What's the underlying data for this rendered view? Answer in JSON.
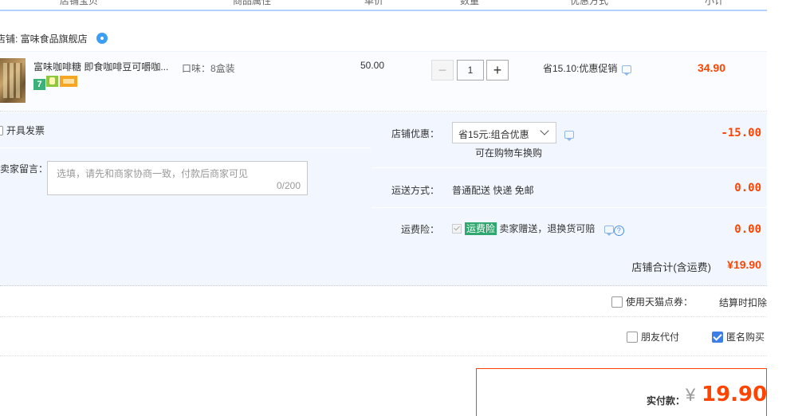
{
  "header": {
    "columns": [
      "店铺宝贝",
      "商品属性",
      "单价",
      "数量",
      "优惠方式",
      "小计"
    ]
  },
  "shop": {
    "label": "店铺: 富味食品旗舰店"
  },
  "item": {
    "title": "富味咖啡糖 即食咖啡豆可嚼咖...",
    "badge_7": "7",
    "attr": "口味：8盒装",
    "price": "50.00",
    "qty": "1",
    "qty_minus": "−",
    "qty_plus": "+",
    "promo": "省15.10:优惠促销",
    "subtotal": "34.90"
  },
  "options": {
    "invoice_label": "开具发票",
    "message_label": "卖家留言：",
    "message_placeholder": "选填，请先和商家协商一致，付款后商家可见",
    "message_count": "0/200",
    "shop_discount_label": "店铺优惠：",
    "shop_discount_select": "省15元:组合优惠",
    "shop_discount_note": "可在购物车换购",
    "shop_discount_value": "-15.00",
    "shipping_label": "运送方式：",
    "shipping_value": "普通配送 快递 免邮",
    "shipping_amount": "0.00",
    "insurance_label": "运费险：",
    "insurance_tag": "运费险",
    "insurance_text": "卖家赠送，退换货可赔",
    "insurance_amount": "0.00",
    "insurance_help": "?"
  },
  "store_total": {
    "label": "店铺合计(含运费)",
    "value": "¥19.90"
  },
  "voucher": {
    "label": "使用天猫点券：",
    "note": "结算时扣除"
  },
  "extras": {
    "friend_pay": "朋友代付",
    "anonymous": "匿名购买",
    "anonymous_checked": true
  },
  "payment": {
    "label": "实付款：",
    "currency": "¥",
    "amount": "19.90"
  },
  "colors": {
    "accent_red": "#ff4400",
    "header_line": "#b2d1ff",
    "panel_bg": "#f2f7ff",
    "checkbox_blue": "#3d7fe6"
  }
}
